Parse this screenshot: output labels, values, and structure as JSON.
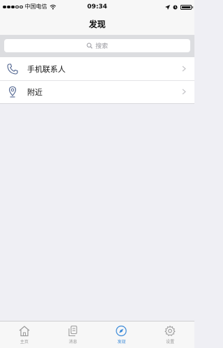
{
  "status": {
    "carrier": "中国电信",
    "time": "09:34"
  },
  "nav": {
    "title": "发现"
  },
  "search": {
    "placeholder": "搜索"
  },
  "list": [
    {
      "label": "手机联系人",
      "icon": "phone-icon"
    },
    {
      "label": "附近",
      "icon": "location-pin-icon"
    }
  ],
  "tabs": [
    {
      "label": "主页",
      "icon": "home-icon",
      "active": false
    },
    {
      "label": "消息",
      "icon": "message-icon",
      "active": false
    },
    {
      "label": "发现",
      "icon": "compass-icon",
      "active": true
    },
    {
      "label": "设置",
      "icon": "gear-icon",
      "active": false
    }
  ],
  "colors": {
    "accent": "#3b8ad8",
    "inactive": "#9a9a9a",
    "background": "#efeff4"
  }
}
